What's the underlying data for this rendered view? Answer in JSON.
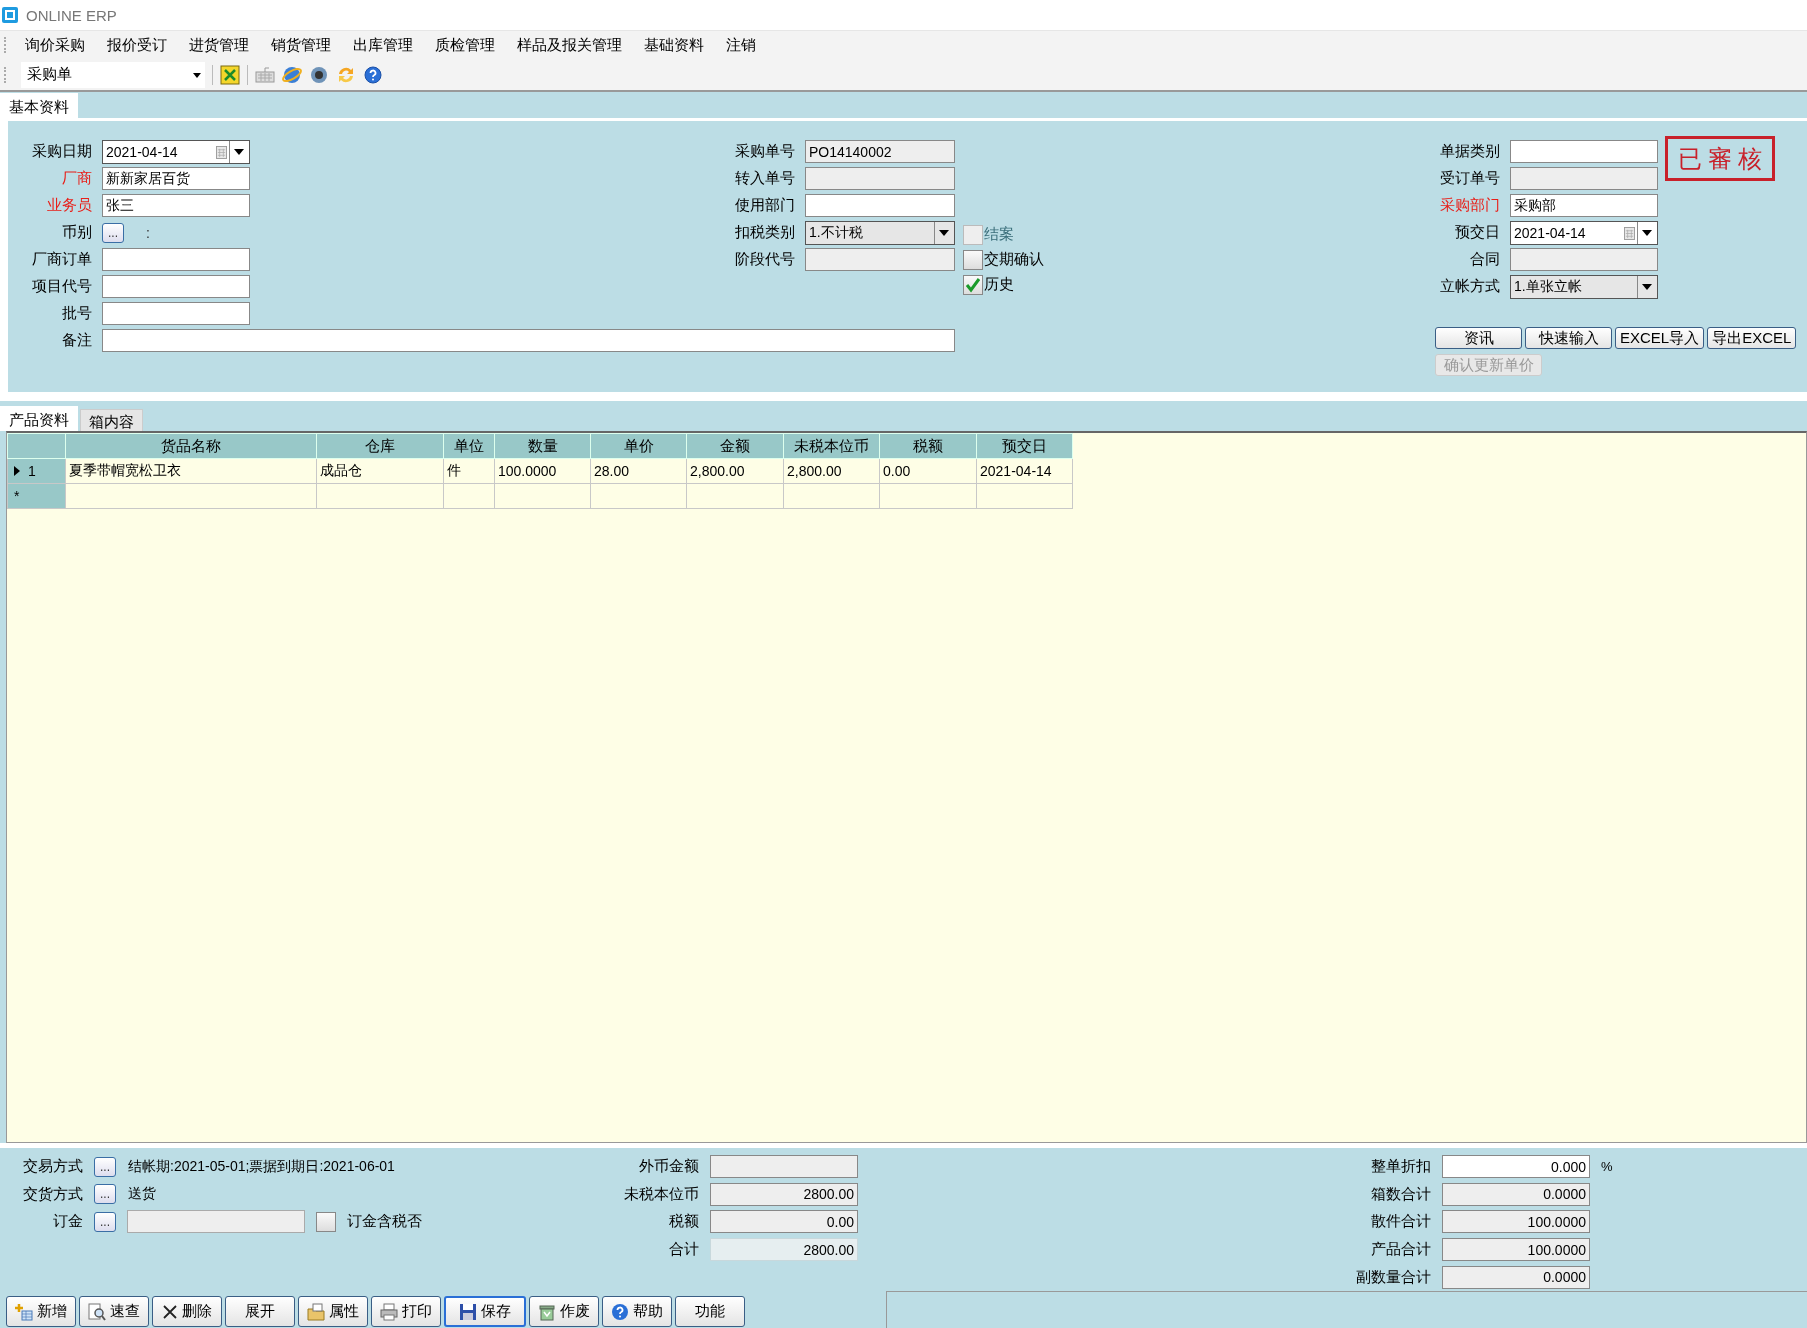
{
  "window": {
    "title": "ONLINE ERP"
  },
  "menu": [
    "询价采购",
    "报价受订",
    "进货管理",
    "销货管理",
    "出库管理",
    "质检管理",
    "样品及报关管理",
    "基础资料",
    "注销"
  ],
  "toolbar": {
    "document_type": "采购单"
  },
  "header_tabs": [
    {
      "label": "基本资料",
      "selected": true
    }
  ],
  "form": {
    "left_fields": [
      {
        "kind": "date",
        "label": "采购日期",
        "required": false,
        "value": "2021-04-14"
      },
      {
        "kind": "text",
        "label": "厂商",
        "required": true,
        "value": "新新家居百货"
      },
      {
        "kind": "text",
        "label": "业务员",
        "required": true,
        "value": "张三"
      },
      {
        "kind": "picker",
        "label": "币别",
        "required": false,
        "button": "...",
        "value": ":"
      },
      {
        "kind": "text",
        "label": "厂商订单",
        "required": false
      },
      {
        "kind": "text",
        "label": "项目代号",
        "required": false
      },
      {
        "kind": "text",
        "label": "批号",
        "required": false
      }
    ],
    "remarks": {
      "label": "备注"
    },
    "middle_fields": [
      {
        "kind": "readonly",
        "label": "采购单号",
        "required": false,
        "value": "PO14140002"
      },
      {
        "kind": "readonly",
        "label": "转入单号",
        "required": false
      },
      {
        "kind": "text",
        "label": "使用部门",
        "required": false
      },
      {
        "kind": "select",
        "label": "扣税类别",
        "required": false,
        "value": "1.不计税"
      },
      {
        "kind": "readonly",
        "label": "阶段代号",
        "required": false
      }
    ],
    "checkboxes": [
      {
        "label": "结案",
        "checked": false,
        "disabled": true
      },
      {
        "label": "交期确认",
        "checked": false,
        "disabled": false
      },
      {
        "label": "历史",
        "checked": true,
        "disabled": false
      }
    ],
    "right_fields": [
      {
        "kind": "text",
        "label": "单据类别",
        "required": false
      },
      {
        "kind": "readonly",
        "label": "受订单号",
        "required": false
      },
      {
        "kind": "text",
        "label": "采购部门",
        "required": true,
        "value": "采购部"
      },
      {
        "kind": "date",
        "label": "预交日",
        "required": false,
        "value": "2021-04-14"
      },
      {
        "kind": "readonly",
        "label": "合同",
        "required": false
      },
      {
        "kind": "select",
        "label": "立帐方式",
        "required": false,
        "value": "1.单张立帐"
      }
    ],
    "stamp": "已 審 核",
    "buttons": [
      {
        "label": "资讯",
        "disabled": false
      },
      {
        "label": "快速输入",
        "disabled": false
      },
      {
        "label": "EXCEL导入",
        "disabled": false
      },
      {
        "label": "导出EXCEL",
        "disabled": false
      }
    ],
    "extra_buttons": [
      {
        "label": "确认更新单价",
        "disabled": true
      }
    ]
  },
  "detail_tabs": [
    {
      "label": "产品资料",
      "selected": true
    },
    {
      "label": "箱内容",
      "selected": false
    }
  ],
  "grid": {
    "columns": [
      "货品名称",
      "仓库",
      "单位",
      "数量",
      "单价",
      "金额",
      "未税本位币",
      "税额",
      "预交日"
    ],
    "rows": [
      {
        "kind": "data",
        "current": true,
        "row_header": "1",
        "cells": [
          "夏季带帽宽松卫衣",
          "成品仓",
          "件",
          "100.0000",
          "28.00",
          "2,800.00",
          "2,800.00",
          "0.00",
          "2021-04-14"
        ]
      },
      {
        "kind": "new",
        "current": false,
        "row_header": "*"
      }
    ]
  },
  "bottom": {
    "left_fields": [
      {
        "kind": "picker",
        "label": "交易方式",
        "button": "...",
        "value": "结帐期:2021-05-01;票据到期日:2021-06-01"
      },
      {
        "kind": "picker",
        "label": "交货方式",
        "button": "...",
        "value": "送货"
      },
      {
        "kind": "picker_field",
        "label": "订金",
        "button": "...",
        "checkbox": {
          "label": "订金含税否",
          "checked": false
        }
      }
    ],
    "amounts": [
      {
        "kind": "readonly",
        "label": "外币金额"
      },
      {
        "kind": "readonly",
        "label": "未税本位币",
        "value": "2800.00"
      },
      {
        "kind": "readonly",
        "label": "税额",
        "value": "0.00"
      },
      {
        "kind": "flat",
        "label": "合计",
        "value": "2800.00"
      }
    ],
    "totals": [
      {
        "kind": "text",
        "label": "整单折扣",
        "value": "0.000",
        "unit": "%"
      },
      {
        "kind": "readonly",
        "label": "箱数合计",
        "value": "0.0000"
      },
      {
        "kind": "readonly",
        "label": "散件合计",
        "value": "100.0000"
      },
      {
        "kind": "readonly",
        "label": "产品合计",
        "value": "100.0000"
      },
      {
        "kind": "readonly",
        "label": "副数量合计",
        "value": "0.0000"
      }
    ]
  },
  "actions": [
    {
      "label": "新增",
      "kind": "add",
      "focused": false
    },
    {
      "label": "速查",
      "kind": "search",
      "focused": false
    },
    {
      "label": "删除",
      "kind": "delete",
      "focused": false
    },
    {
      "label": "展开",
      "kind": "plain",
      "focused": false
    },
    {
      "label": "属性",
      "kind": "properties",
      "focused": false
    },
    {
      "label": "打印",
      "kind": "print",
      "focused": false
    },
    {
      "label": "保存",
      "kind": "save",
      "focused": true
    },
    {
      "label": "作废",
      "kind": "void",
      "focused": false
    },
    {
      "label": "帮助",
      "kind": "help",
      "focused": false
    },
    {
      "label": "功能",
      "kind": "plain",
      "focused": false
    }
  ]
}
